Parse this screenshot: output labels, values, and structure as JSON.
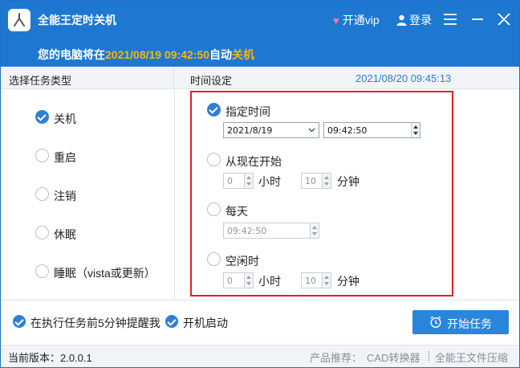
{
  "app": {
    "title": "全能王定时关机",
    "vip_label": "开通vip",
    "login_label": "登录"
  },
  "notice": {
    "prefix": "您的电脑将在",
    "datetime": "2021/08/19 09:42:50",
    "middle": "自动",
    "action": "关机"
  },
  "columns": {
    "task_type_header": "选择任务类型",
    "time_header": "时间设定",
    "current_time": "2021/08/20 09:45:13"
  },
  "task_types": [
    {
      "label": "关机",
      "selected": true
    },
    {
      "label": "重启",
      "selected": false
    },
    {
      "label": "注销",
      "selected": false
    },
    {
      "label": "休眠",
      "selected": false
    },
    {
      "label": "睡眠（vista或更新）",
      "selected": false
    }
  ],
  "time_options": {
    "specified": {
      "label": "指定时间",
      "selected": true,
      "date": "2021/8/19",
      "time": "09:42:50"
    },
    "from_now": {
      "label": "从现在开始",
      "selected": false,
      "hours": "0",
      "hours_unit": "小时",
      "minutes": "10",
      "minutes_unit": "分钟"
    },
    "daily": {
      "label": "每天",
      "selected": false,
      "time": "09:42:50"
    },
    "idle": {
      "label": "空闲时",
      "selected": false,
      "hours": "0",
      "hours_unit": "小时",
      "minutes": "10",
      "minutes_unit": "分钟"
    }
  },
  "bottom": {
    "remind_label": "在执行任务前5分钟提醒我",
    "remind_checked": true,
    "autostart_label": "开机启动",
    "autostart_checked": true,
    "start_button": "开始任务"
  },
  "footer": {
    "version": "当前版本：2.0.0.1",
    "promo_prefix": "产品推荐：",
    "promo_cad": "CAD转换器",
    "promo_pdf": "全能王文件压缩"
  },
  "colors": {
    "header_bg": "#1e78d2",
    "accent": "#2a86dc",
    "highlight": "#ffb400",
    "box_border": "#e02020"
  },
  "icons": [
    "app-logo-icon",
    "heart-icon",
    "user-icon",
    "menu-icon",
    "minimize-icon",
    "close-icon",
    "clock-icon",
    "chevron-down-icon"
  ]
}
